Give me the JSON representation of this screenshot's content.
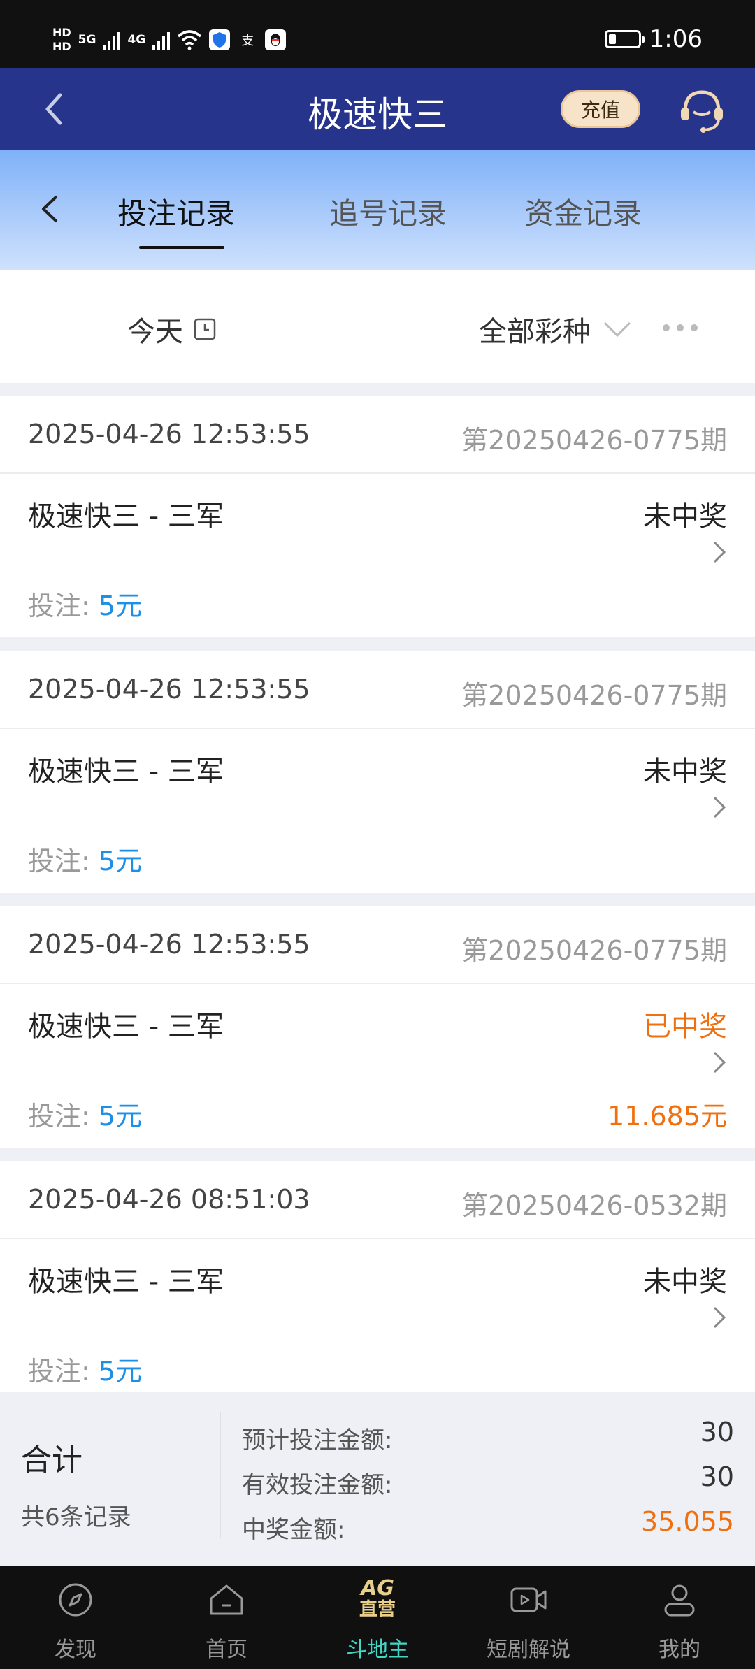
{
  "statusbar": {
    "hd1": "HD",
    "hd2": "HD",
    "net1": "5G",
    "net2": "4G",
    "alipay_glyph": "支",
    "time": "1:06"
  },
  "navbar": {
    "title": "极速快三",
    "recharge_label": "充值"
  },
  "tabs": [
    {
      "label": "投注记录",
      "active": true
    },
    {
      "label": "追号记录",
      "active": false
    },
    {
      "label": "资金记录",
      "active": false
    }
  ],
  "filter": {
    "date_label": "今天",
    "type_label": "全部彩种"
  },
  "records": [
    {
      "datetime": "2025-04-26 12:53:55",
      "issue": "第20250426-0775期",
      "name": "极速快三 - 三军",
      "status": "未中奖",
      "bet_label": "投注:",
      "bet_amount": "5元",
      "prize": ""
    },
    {
      "datetime": "2025-04-26 12:53:55",
      "issue": "第20250426-0775期",
      "name": "极速快三 - 三军",
      "status": "未中奖",
      "bet_label": "投注:",
      "bet_amount": "5元",
      "prize": ""
    },
    {
      "datetime": "2025-04-26 12:53:55",
      "issue": "第20250426-0775期",
      "name": "极速快三 - 三军",
      "status": "已中奖",
      "bet_label": "投注:",
      "bet_amount": "5元",
      "prize": "11.685元"
    },
    {
      "datetime": "2025-04-26 08:51:03",
      "issue": "第20250426-0532期",
      "name": "极速快三 - 三军",
      "status": "未中奖",
      "bet_label": "投注:",
      "bet_amount": "5元",
      "prize": ""
    }
  ],
  "summary": {
    "title": "合计",
    "count": "共6条记录",
    "expected_label": "预计投注金额:",
    "expected_value": "30",
    "valid_label": "有效投注金额:",
    "valid_value": "30",
    "prize_label": "中奖金额:",
    "prize_value": "35.055"
  },
  "bottom_nav": [
    {
      "label": "发现",
      "icon": "compass-icon"
    },
    {
      "label": "首页",
      "icon": "home-icon"
    },
    {
      "label": "斗地主",
      "icon": "ag-logo",
      "logo_top": "AG",
      "logo_bottom": "直营",
      "active": true
    },
    {
      "label": "短剧解说",
      "icon": "video-icon"
    },
    {
      "label": "我的",
      "icon": "user-icon"
    }
  ],
  "colors": {
    "nav_bg": "#27348b",
    "win": "#f07010",
    "bet_amount": "#1e8fe6",
    "active_tab": "#42d6c4"
  }
}
